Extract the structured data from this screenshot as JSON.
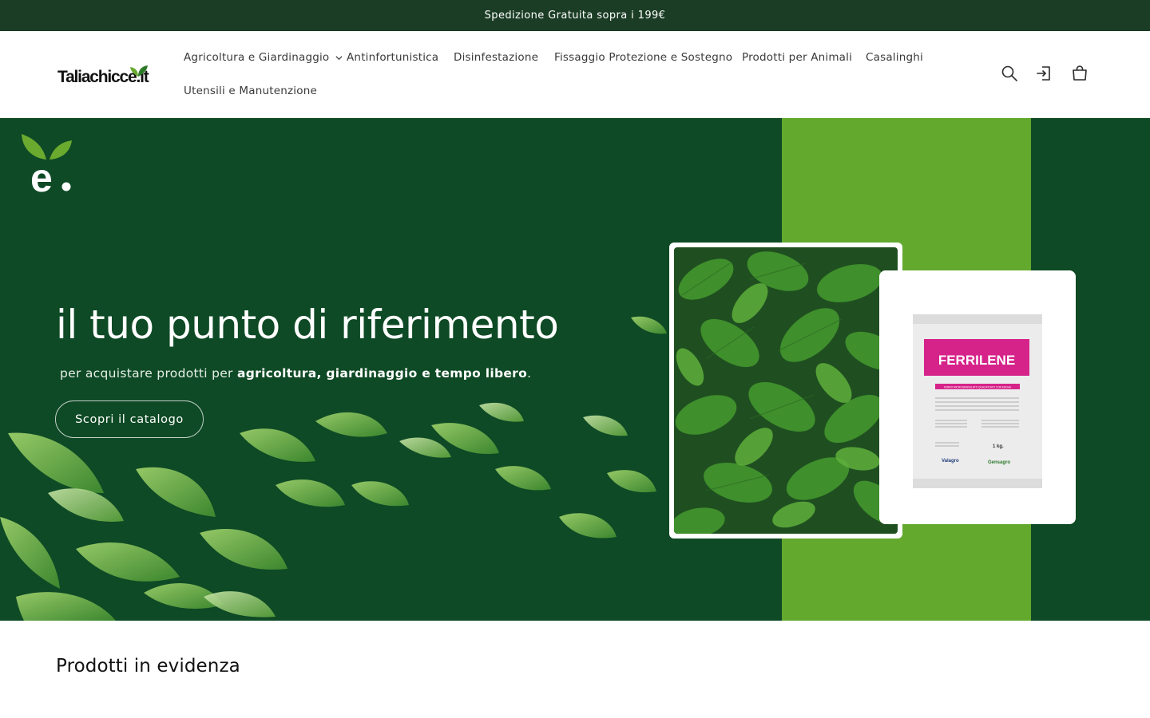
{
  "announcement": {
    "text": "Spedizione Gratuita sopra i 199€"
  },
  "header": {
    "logo": {
      "text": "Taliachicce.it",
      "alt": "Taliachicce.it"
    },
    "nav": [
      {
        "label": "Agricoltura e Giardinaggio",
        "has_dropdown": true
      },
      {
        "label": "Antinfortunistica"
      },
      {
        "label": "Disinfestazione"
      },
      {
        "label": "Fissaggio Protezione e Sostegno"
      },
      {
        "label": "Prodotti per Animali"
      },
      {
        "label": "Casalinghi"
      },
      {
        "label": "Utensili e Manutenzione"
      }
    ],
    "icons": [
      "search-icon",
      "account-icon",
      "cart-icon"
    ]
  },
  "hero": {
    "title": "il tuo punto di riferimento",
    "subtitle_prefix": "per acquistare prodotti per",
    "subtitle_bold": "agricoltura, giardinaggio e tempo libero",
    "subtitle_suffix": ".",
    "button_label": "Scopri il catalogo",
    "product": {
      "name": "FERRILENE",
      "description": "FERRO MICROGRANULATO QUALIFICATO CON EDDHA",
      "weight": "1 kg.",
      "brand_left": "Valagro",
      "brand_right": "Gensagro"
    }
  },
  "featured": {
    "title": "Prodotti in evidenza"
  },
  "colors": {
    "announcement_bg": "#1b3d25",
    "hero_bg": "#0e4a25",
    "hero_stripe": "#63a92e",
    "product_accent": "#d6238a"
  }
}
